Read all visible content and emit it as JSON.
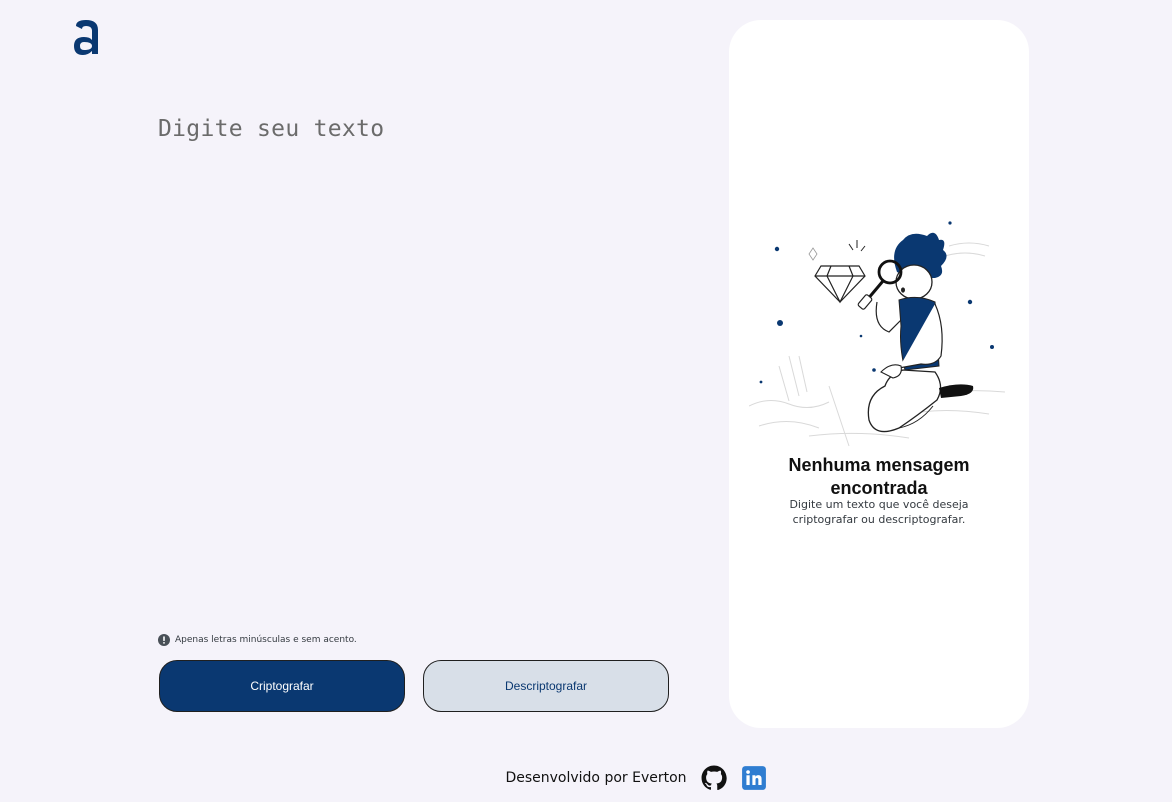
{
  "brand": {
    "logo_icon": "alura-logo-icon",
    "color": "#0a3871"
  },
  "editor": {
    "placeholder": "Digite seu texto",
    "value": ""
  },
  "hint": {
    "icon": "info-icon",
    "text": "Apenas letras minúsculas e sem acento."
  },
  "actions": {
    "encrypt_label": "Criptografar",
    "decrypt_label": "Descriptografar"
  },
  "output_panel": {
    "illustration": "person-with-magnifying-glass-illustration",
    "title": "Nenhuma mensagem encontrada",
    "subtitle": "Digite um texto que você deseja criptografar ou descriptografar."
  },
  "footer": {
    "text": "Desenvolvido por Everton",
    "links": [
      {
        "icon": "github-icon"
      },
      {
        "icon": "linkedin-icon"
      }
    ]
  },
  "colors": {
    "background": "#f5f3fa",
    "primary": "#0a3871",
    "secondary_button": "#d8dfe8",
    "panel": "#ffffff"
  }
}
